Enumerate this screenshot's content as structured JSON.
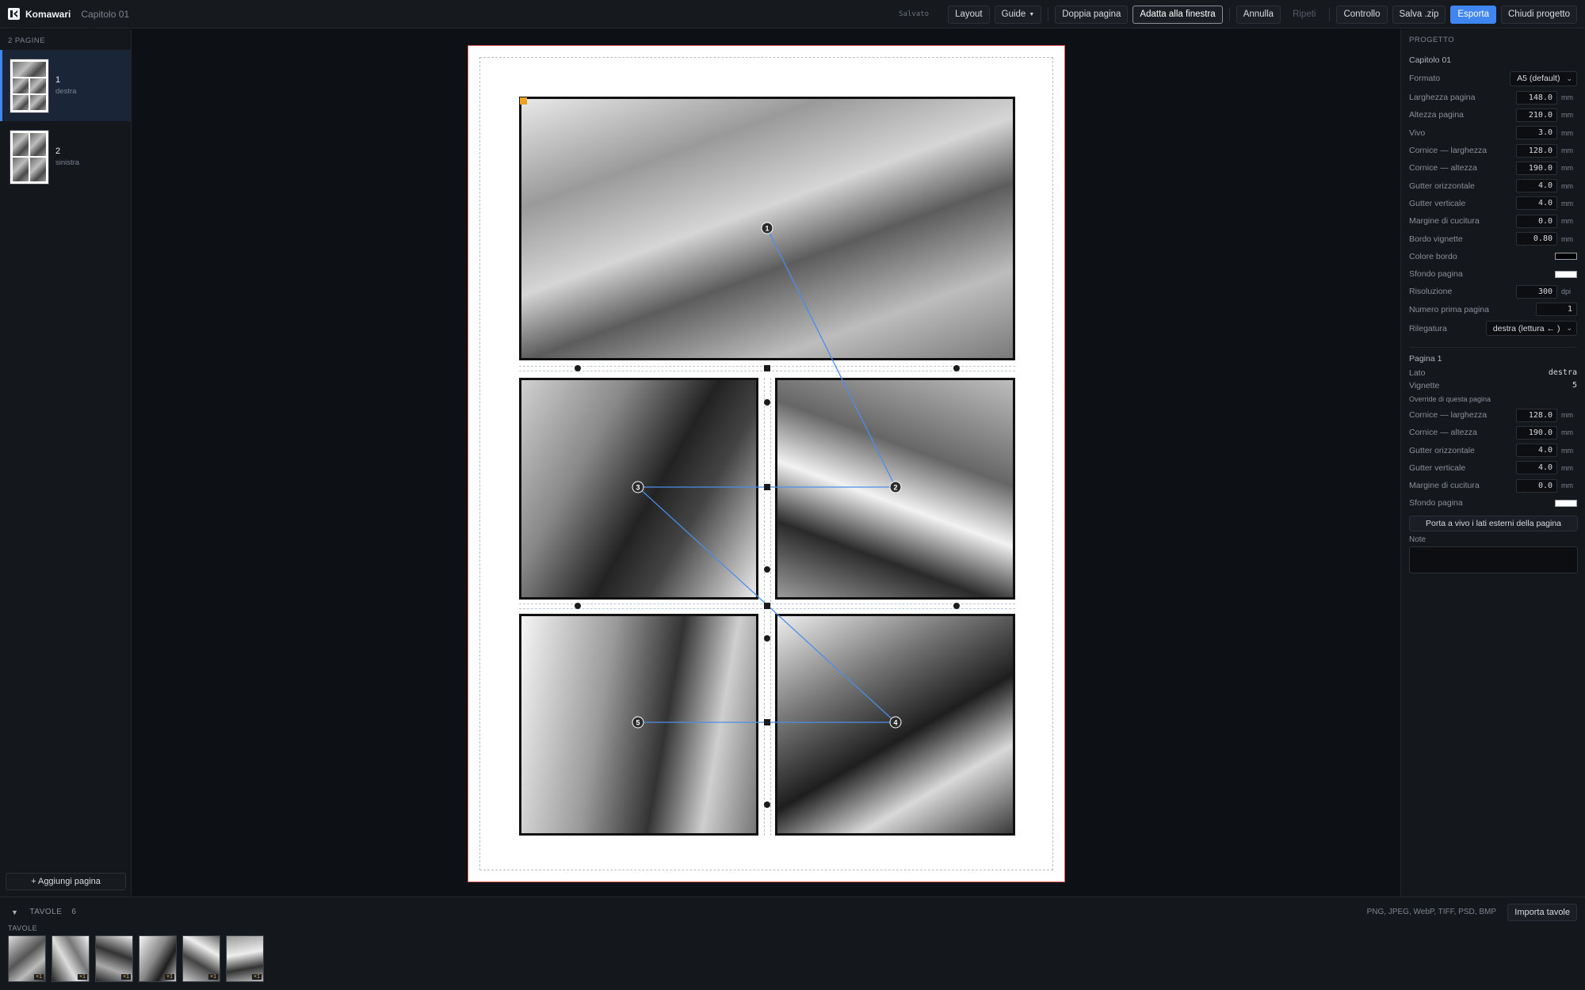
{
  "app": {
    "name": "Komawari",
    "project": "Capitolo 01"
  },
  "toolbar": {
    "saved": "Salvato",
    "layout": "Layout",
    "guides": "Guide",
    "double_page": "Doppia pagina",
    "fit_window": "Adatta alla finestra",
    "undo": "Annulla",
    "redo": "Ripeti",
    "check": "Controllo",
    "save_zip": "Salva .zip",
    "export": "Esporta",
    "close_project": "Chiudi progetto"
  },
  "sidebar": {
    "header": "2 PAGINE",
    "pages": [
      {
        "number": "1",
        "side": "destra"
      },
      {
        "number": "2",
        "side": "sinistra"
      }
    ],
    "add_page": "+ Aggiungi pagina"
  },
  "canvas": {
    "panel_badges": [
      "1",
      "2",
      "3",
      "4",
      "5"
    ]
  },
  "properties": {
    "section": "PROGETTO",
    "project_name": "Capitolo 01",
    "format_label": "Formato",
    "format_value": "A5 (default)",
    "fields": [
      {
        "label": "Larghezza pagina",
        "value": "148.0",
        "unit": "mm"
      },
      {
        "label": "Altezza pagina",
        "value": "210.0",
        "unit": "mm"
      },
      {
        "label": "Vivo",
        "value": "3.0",
        "unit": "mm"
      },
      {
        "label": "Cornice — larghezza",
        "value": "128.0",
        "unit": "mm"
      },
      {
        "label": "Cornice — altezza",
        "value": "190.0",
        "unit": "mm"
      },
      {
        "label": "Gutter orizzontale",
        "value": "4.0",
        "unit": "mm"
      },
      {
        "label": "Gutter verticale",
        "value": "4.0",
        "unit": "mm"
      },
      {
        "label": "Margine di cucitura",
        "value": "0.0",
        "unit": "mm"
      },
      {
        "label": "Bordo vignette",
        "value": "0.80",
        "unit": "mm"
      }
    ],
    "border_color_label": "Colore bordo",
    "border_color": "#000000",
    "page_bg_label": "Sfondo pagina",
    "page_bg": "#ffffff",
    "resolution_label": "Risoluzione",
    "resolution_value": "300",
    "resolution_unit": "dpi",
    "first_page_label": "Numero prima pagina",
    "first_page_value": "1",
    "binding_label": "Rilegatura",
    "binding_value": "destra (lettura ← )",
    "page_section": "Pagina 1",
    "side_label": "Lato",
    "side_value": "destra",
    "panels_label": "Vignette",
    "panels_value": "5",
    "override_label": "Override di questa pagina",
    "override_fields": [
      {
        "label": "Cornice — larghezza",
        "value": "128.0",
        "unit": "mm"
      },
      {
        "label": "Cornice — altezza",
        "value": "190.0",
        "unit": "mm"
      },
      {
        "label": "Gutter orizzontale",
        "value": "4.0",
        "unit": "mm"
      },
      {
        "label": "Gutter verticale",
        "value": "4.0",
        "unit": "mm"
      },
      {
        "label": "Margine di cucitura",
        "value": "0.0",
        "unit": "mm"
      }
    ],
    "override_bg_label": "Sfondo pagina",
    "bleed_button": "Porta a vivo i lati esterni della pagina",
    "notes_label": "Note"
  },
  "bottom": {
    "header": "TAVOLE",
    "count": "6",
    "list_label": "TAVOLE",
    "multiplier": "×1",
    "formats": "PNG, JPEG, WebP, TIFF, PSD, BMP",
    "import": "Importa tavole"
  },
  "colors": {
    "accent": "#3f86f1",
    "page_edge": "#e05a5a",
    "corner_marker": "#f0a11d",
    "flow_line": "#4a8ee8"
  }
}
